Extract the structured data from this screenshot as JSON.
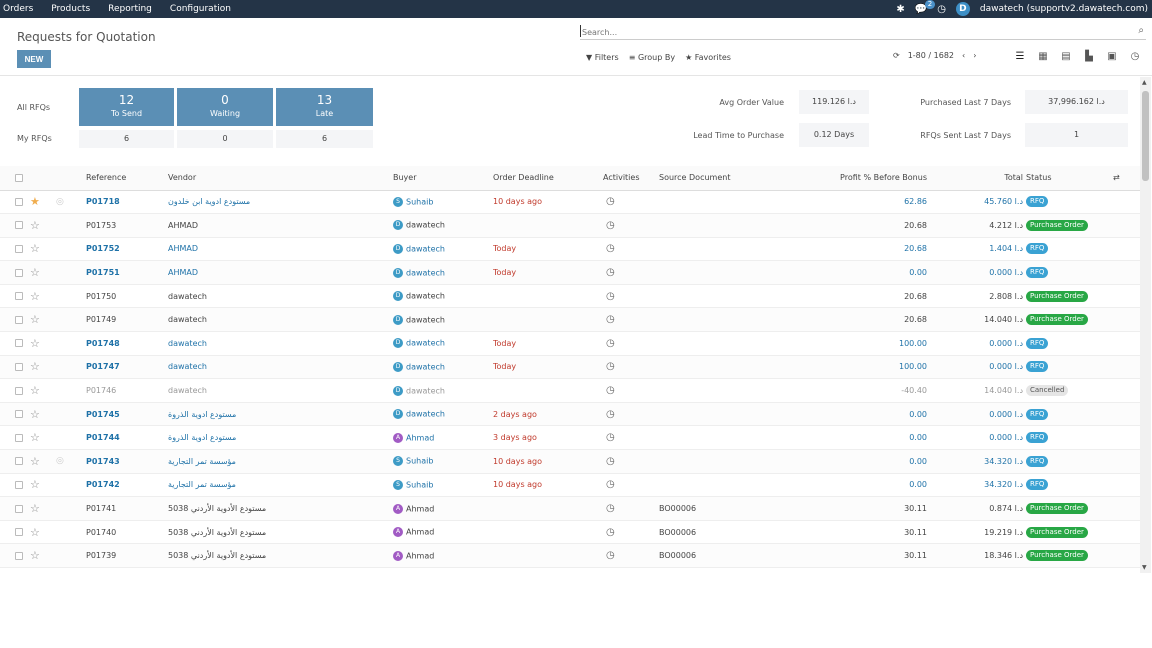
{
  "navbar": {
    "menu": [
      "Orders",
      "Products",
      "Reporting",
      "Configuration"
    ],
    "chat_count": "2",
    "user_initial": "D",
    "user_name": "dawatech (supportv2.dawatech.com)"
  },
  "control_panel": {
    "title": "Requests for Quotation",
    "new_label": "NEW",
    "search_placeholder": "Search...",
    "filters_label": "Filters",
    "groupby_label": "Group By",
    "favorites_label": "Favorites",
    "pager_text": "1-80 / 1682"
  },
  "dashboard": {
    "all_rfqs_label": "All RFQs",
    "my_rfqs_label": "My RFQs",
    "tiles": [
      {
        "num": "12",
        "label": "To Send",
        "mine": "6"
      },
      {
        "num": "0",
        "label": "Waiting",
        "mine": "0"
      },
      {
        "num": "13",
        "label": "Late",
        "mine": "6"
      }
    ],
    "kpis": [
      {
        "label": "Avg Order Value",
        "value": "119.126 د.ا"
      },
      {
        "label": "Purchased Last 7 Days",
        "value": "37,996.162 د.ا"
      },
      {
        "label": "Lead Time to Purchase",
        "value": "0.12 Days"
      },
      {
        "label": "RFQs Sent Last 7 Days",
        "value": "1"
      }
    ]
  },
  "table": {
    "headers": {
      "reference": "Reference",
      "vendor": "Vendor",
      "buyer": "Buyer",
      "deadline": "Order Deadline",
      "activities": "Activities",
      "source": "Source Document",
      "profit": "Profit % Before Bonus",
      "total": "Total",
      "status": "Status"
    },
    "rows": [
      {
        "ref": "P01718",
        "vendor": "مستودع ادوية ابن خلدون",
        "buyer": "Suhaib",
        "buyer_initial": "S",
        "deadline": "10 days ago",
        "source": "",
        "profit": "62.86",
        "total": "45.760 د.ا",
        "status": "RFQ",
        "favorite": true,
        "chat": true,
        "highlight": true,
        "cancelled": false,
        "late": true
      },
      {
        "ref": "P01753",
        "vendor": "AHMAD",
        "buyer": "dawatech",
        "buyer_initial": "D",
        "deadline": "",
        "source": "",
        "profit": "20.68",
        "total": "4.212 د.ا",
        "status": "Purchase Order",
        "favorite": false,
        "chat": false,
        "highlight": false,
        "cancelled": false,
        "late": false
      },
      {
        "ref": "P01752",
        "vendor": "AHMAD",
        "buyer": "dawatech",
        "buyer_initial": "D",
        "deadline": "Today",
        "source": "",
        "profit": "20.68",
        "total": "1.404 د.ا",
        "status": "RFQ",
        "favorite": false,
        "chat": false,
        "highlight": true,
        "cancelled": false,
        "late": true
      },
      {
        "ref": "P01751",
        "vendor": "AHMAD",
        "buyer": "dawatech",
        "buyer_initial": "D",
        "deadline": "Today",
        "source": "",
        "profit": "0.00",
        "total": "0.000 د.ا",
        "status": "RFQ",
        "favorite": false,
        "chat": false,
        "highlight": true,
        "cancelled": false,
        "late": true
      },
      {
        "ref": "P01750",
        "vendor": "dawatech",
        "buyer": "dawatech",
        "buyer_initial": "D",
        "deadline": "",
        "source": "",
        "profit": "20.68",
        "total": "2.808 د.ا",
        "status": "Purchase Order",
        "favorite": false,
        "chat": false,
        "highlight": false,
        "cancelled": false,
        "late": false
      },
      {
        "ref": "P01749",
        "vendor": "dawatech",
        "buyer": "dawatech",
        "buyer_initial": "D",
        "deadline": "",
        "source": "",
        "profit": "20.68",
        "total": "14.040 د.ا",
        "status": "Purchase Order",
        "favorite": false,
        "chat": false,
        "highlight": false,
        "cancelled": false,
        "late": false
      },
      {
        "ref": "P01748",
        "vendor": "dawatech",
        "buyer": "dawatech",
        "buyer_initial": "D",
        "deadline": "Today",
        "source": "",
        "profit": "100.00",
        "total": "0.000 د.ا",
        "status": "RFQ",
        "favorite": false,
        "chat": false,
        "highlight": true,
        "cancelled": false,
        "late": false
      },
      {
        "ref": "P01747",
        "vendor": "dawatech",
        "buyer": "dawatech",
        "buyer_initial": "D",
        "deadline": "Today",
        "source": "",
        "profit": "100.00",
        "total": "0.000 د.ا",
        "status": "RFQ",
        "favorite": false,
        "chat": false,
        "highlight": true,
        "cancelled": false,
        "late": false
      },
      {
        "ref": "P01746",
        "vendor": "dawatech",
        "buyer": "dawatech",
        "buyer_initial": "D",
        "deadline": "",
        "source": "",
        "profit": "-40.40",
        "total": "14.040 د.ا",
        "status": "Cancelled",
        "favorite": false,
        "chat": false,
        "highlight": false,
        "cancelled": true,
        "late": false
      },
      {
        "ref": "P01745",
        "vendor": "مستودع ادوية الذروة",
        "buyer": "dawatech",
        "buyer_initial": "D",
        "deadline": "2 days ago",
        "source": "",
        "profit": "0.00",
        "total": "0.000 د.ا",
        "status": "RFQ",
        "favorite": false,
        "chat": false,
        "highlight": true,
        "cancelled": false,
        "late": true
      },
      {
        "ref": "P01744",
        "vendor": "مستودع ادوية الذروة",
        "buyer": "Ahmad",
        "buyer_initial": "A",
        "deadline": "3 days ago",
        "source": "",
        "profit": "0.00",
        "total": "0.000 د.ا",
        "status": "RFQ",
        "favorite": false,
        "chat": false,
        "highlight": true,
        "cancelled": false,
        "late": true
      },
      {
        "ref": "P01743",
        "vendor": "مؤسسة تمر التجارية",
        "buyer": "Suhaib",
        "buyer_initial": "S",
        "deadline": "10 days ago",
        "source": "",
        "profit": "0.00",
        "total": "34.320 د.ا",
        "status": "RFQ",
        "favorite": false,
        "chat": true,
        "highlight": true,
        "cancelled": false,
        "late": true
      },
      {
        "ref": "P01742",
        "vendor": "مؤسسة تمر التجارية",
        "buyer": "Suhaib",
        "buyer_initial": "S",
        "deadline": "10 days ago",
        "source": "",
        "profit": "0.00",
        "total": "34.320 د.ا",
        "status": "RFQ",
        "favorite": false,
        "chat": false,
        "highlight": true,
        "cancelled": false,
        "late": true
      },
      {
        "ref": "P01741",
        "vendor": "5038 مستودع الأدوية الأردني",
        "buyer": "Ahmad",
        "buyer_initial": "A",
        "deadline": "",
        "source": "BO00006",
        "profit": "30.11",
        "total": "0.874 د.ا",
        "status": "Purchase Order",
        "favorite": false,
        "chat": false,
        "highlight": false,
        "cancelled": false,
        "late": false
      },
      {
        "ref": "P01740",
        "vendor": "5038 مستودع الأدوية الأردني",
        "buyer": "Ahmad",
        "buyer_initial": "A",
        "deadline": "",
        "source": "BO00006",
        "profit": "30.11",
        "total": "19.219 د.ا",
        "status": "Purchase Order",
        "favorite": false,
        "chat": false,
        "highlight": false,
        "cancelled": false,
        "late": false
      },
      {
        "ref": "P01739",
        "vendor": "5038 مستودع الأدوية الأردني",
        "buyer": "Ahmad",
        "buyer_initial": "A",
        "deadline": "",
        "source": "BO00006",
        "profit": "30.11",
        "total": "18.346 د.ا",
        "status": "Purchase Order",
        "favorite": false,
        "chat": false,
        "highlight": false,
        "cancelled": false,
        "late": false
      }
    ]
  },
  "colors": {
    "navbar": "#243447",
    "tile": "#5b8fb5",
    "link": "#1f72a8",
    "late": "#c0392b",
    "rfq_pill": "#3aa2d3",
    "po_pill": "#28a745"
  }
}
